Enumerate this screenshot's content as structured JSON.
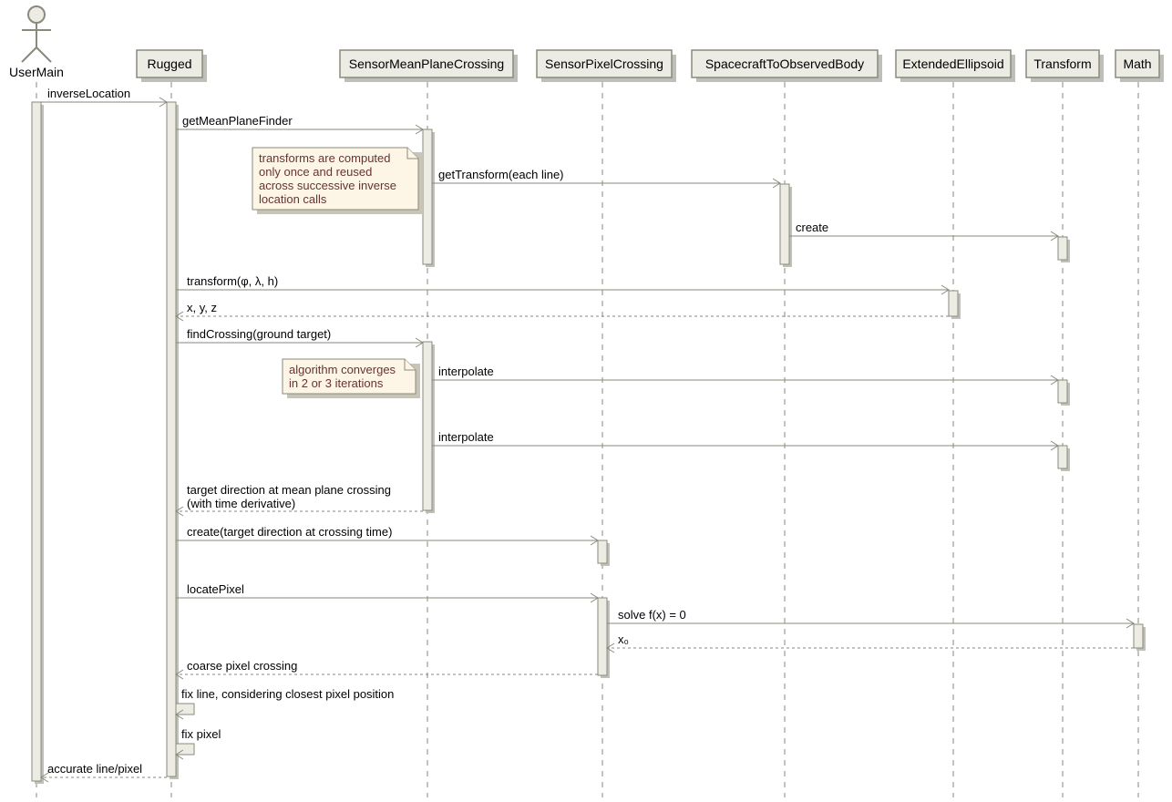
{
  "actor": {
    "name": "UserMain"
  },
  "participants": [
    {
      "name": "Rugged"
    },
    {
      "name": "SensorMeanPlaneCrossing"
    },
    {
      "name": "SensorPixelCrossing"
    },
    {
      "name": "SpacecraftToObservedBody"
    },
    {
      "name": "ExtendedEllipsoid"
    },
    {
      "name": "Transform"
    },
    {
      "name": "Math"
    }
  ],
  "messages": {
    "inverseLocation": "inverseLocation",
    "getMeanPlaneFinder": "getMeanPlaneFinder",
    "getTransformEachLine": "getTransform(each line)",
    "create": "create",
    "transform": "transform(φ, λ, h)",
    "xyz": "x, y, z",
    "findCrossing": "findCrossing(ground target)",
    "interpolate1": "interpolate",
    "interpolate2": "interpolate",
    "targetDirection_l1": "target direction at mean plane crossing",
    "targetDirection_l2": "(with time derivative)",
    "createTarget": "create(target direction at crossing time)",
    "locatePixel": "locatePixel",
    "solve": "solve f(x) = 0",
    "x0": "x₀",
    "coarsePixel": "coarse pixel crossing",
    "fixLine": "fix line, considering closest pixel position",
    "fixPixel": "fix pixel",
    "accurate": "accurate line/pixel"
  },
  "notes": {
    "note1_l1": "transforms are computed",
    "note1_l2": "only once and reused",
    "note1_l3": "across successive inverse",
    "note1_l4": "location calls",
    "note2_l1": "algorithm converges",
    "note2_l2": "in 2 or 3 iterations"
  }
}
